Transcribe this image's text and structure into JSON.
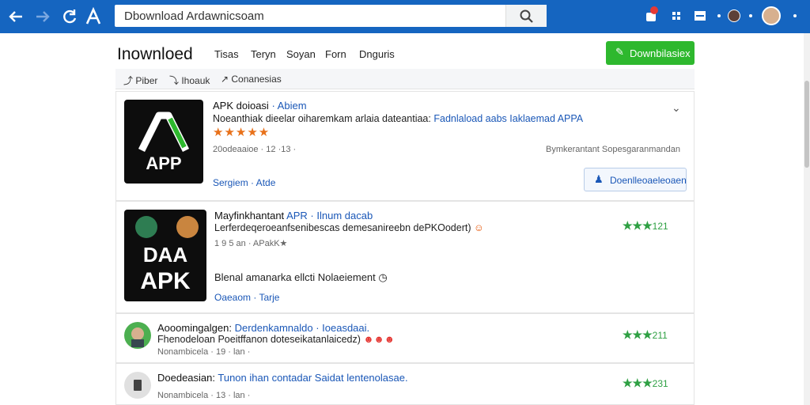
{
  "nav": {
    "back_icon": "arrow-left-icon",
    "forward_icon": "arrow-right-icon",
    "reload_icon": "reload-icon",
    "logo_icon": "app-logo-icon"
  },
  "search": {
    "value": "Dbownload Ardawnicsoam",
    "icon": "search-icon"
  },
  "header": {
    "brand": "Inownloed",
    "menu": [
      "Tisas",
      "Teryn",
      "Soyan",
      "Forn",
      "Dnguris"
    ],
    "download_button": "Downbilasiex"
  },
  "subbar": {
    "items": [
      "Piber",
      "Ihoauk",
      "Conanesias"
    ]
  },
  "results": [
    {
      "thumb_text": "APP",
      "title": "APK doioasi",
      "title_tag": "· Abiem",
      "desc": "Noeanthiak dieelar oiharemkam arlaia dateantiaa:",
      "desc_blue": "Fadnlaload aabs Iaklaemad APPA",
      "stars": "★★★★★",
      "meta": "20odeaaioe · 12 ·13 ·",
      "right_meta": "Bymkerantant  Sopesgaranmandan",
      "link": "Sergiem · Atde",
      "download_label": "Doenlleoaeleoaen"
    },
    {
      "thumb_text_1": "DAA",
      "thumb_text_2": "APK",
      "title": "Mayfinkhantant",
      "title_tag": "APR · Ilnum dacab",
      "desc": "Lerferdeqeroeanfsenibescas demesanireebn dePKOodert)",
      "meta": "1 9 5 an · APakK★",
      "extra": "Blenal amanarka ellcti  Nolaeiement",
      "link": "Oaeaom · Tarje",
      "rating": "★★★",
      "rating_count": "121"
    },
    {
      "title": "Aooomingalgen:",
      "title_blue": "Derdenkamnaldo · Ioeasdaai.",
      "desc": "Fhenodeloan Poeitffanon doteseikatanlaicedz)",
      "meta": "Nonambicela · 19 · lan ·",
      "rating": "★★★",
      "rating_count": "211"
    },
    {
      "title": "Doedeasian:",
      "title_blue": "Tunon ihan contadar Saidat lentenolasae.",
      "meta": "Nonambicela · 13 · lan ·",
      "rating": "★★★",
      "rating_count": "231"
    }
  ],
  "colors": {
    "topbar": "#1565c0",
    "accent_green": "#2eb82e",
    "link_blue": "#1a57b7",
    "star_orange": "#e8711a",
    "rating_green": "#2ea043"
  }
}
